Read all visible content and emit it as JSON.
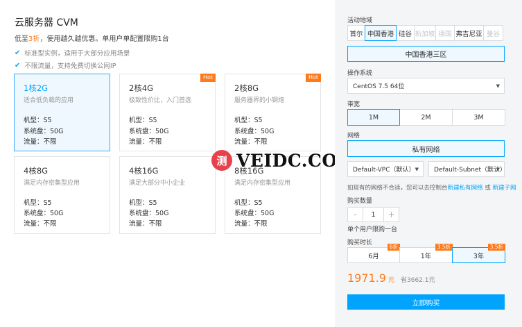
{
  "header": {
    "title": "云服务器 CVM",
    "promo_prefix": "低至",
    "promo_highlight": "3折",
    "promo_suffix": "，使用越久越优惠。单用户单配置限购1台"
  },
  "features": [
    "标准型实例，适用于大部分应用场景",
    "不限流量，支持免费切换公网IP"
  ],
  "spec_labels": {
    "model": "机型：",
    "disk": "系统盘：",
    "traffic": "流量："
  },
  "cards": [
    {
      "name": "1核2G",
      "desc": "适合低负载的应用",
      "model": "S5",
      "disk": "50G",
      "traffic": "不限",
      "hot": ""
    },
    {
      "name": "2核4G",
      "desc": "极致性价比，入门首选",
      "model": "S5",
      "disk": "50G",
      "traffic": "不限",
      "hot": "Hot"
    },
    {
      "name": "2核8G",
      "desc": "服务器界的小钢炮",
      "model": "S5",
      "disk": "50G",
      "traffic": "不限",
      "hot": "Hot"
    },
    {
      "name": "4核8G",
      "desc": "满足内存密集型应用",
      "model": "S5",
      "disk": "50G",
      "traffic": "不限",
      "hot": ""
    },
    {
      "name": "4核16G",
      "desc": "满足大部分中小企业",
      "model": "S5",
      "disk": "50G",
      "traffic": "不限",
      "hot": ""
    },
    {
      "name": "8核16G",
      "desc": "满足内存密集型应用",
      "model": "S5",
      "disk": "50G",
      "traffic": "不限",
      "hot": ""
    }
  ],
  "watermark": {
    "circle": "测",
    "text": "VEIDC.COM"
  },
  "region": {
    "label": "活动地域",
    "options": [
      "首尔",
      "中国香港",
      "硅谷",
      "新加坡",
      "德国",
      "弗吉尼亚",
      "曼谷"
    ],
    "zone": "中国香港三区"
  },
  "os": {
    "label": "操作系统",
    "value": "CentOS 7.5 64位"
  },
  "bandwidth": {
    "label": "带宽",
    "options": [
      "1M",
      "2M",
      "3M"
    ]
  },
  "network": {
    "label": "网络",
    "type": "私有网络",
    "vpc": "Default-VPC（默认）",
    "subnet": "Default-Subnet（默认）",
    "note_prefix": "如现有的网络不合适，您可以去控制台",
    "link1": "新建私有网络",
    "note_mid": "或",
    "link2": "新建子网"
  },
  "quantity": {
    "label": "购买数量",
    "minus": "-",
    "value": "1",
    "plus": "+",
    "limit": "单个用户限购一台"
  },
  "duration": {
    "label": "购买时长",
    "options": [
      {
        "label": "6月",
        "tag": "6折"
      },
      {
        "label": "1年",
        "tag": "3.5折"
      },
      {
        "label": "3年",
        "tag": "3.5折"
      }
    ]
  },
  "price": {
    "value": "1971.9",
    "unit": "元",
    "save": "省3662.1元"
  },
  "buy_label": "立即购买",
  "colors": {
    "accent": "#00a4ff",
    "highlight": "#ff7a1a",
    "panel": "#f4f5f7"
  }
}
